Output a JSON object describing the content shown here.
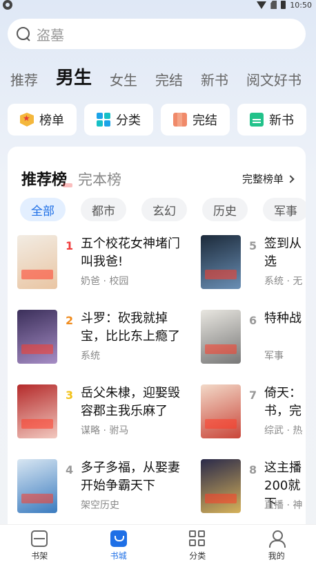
{
  "status_bar": {
    "time": "10:50"
  },
  "search": {
    "placeholder": "盗墓"
  },
  "top_tabs": [
    "推荐",
    "男生",
    "女生",
    "完结",
    "新书",
    "阅文好书"
  ],
  "shortcuts": [
    {
      "label": "榜单",
      "icon": "ranking-icon"
    },
    {
      "label": "分类",
      "icon": "category-icon"
    },
    {
      "label": "完结",
      "icon": "finished-books-icon"
    },
    {
      "label": "新书",
      "icon": "new-book-icon"
    }
  ],
  "ranking": {
    "tabs": [
      "推荐榜",
      "完本榜"
    ],
    "full_list_label": "完整榜单",
    "genres": [
      "全部",
      "都市",
      "玄幻",
      "历史",
      "军事"
    ],
    "books": [
      {
        "rank": "1",
        "title": "五个校花女神堵门叫我爸!",
        "tags": "奶爸 · 校园",
        "cover": [
          "#f2ece3",
          "#e9c5a3"
        ]
      },
      {
        "rank": "2",
        "title": "斗罗：砍我就掉宝，比比东上瘾了",
        "tags": "系统",
        "cover": [
          "#3b2f5a",
          "#a68dc5"
        ]
      },
      {
        "rank": "3",
        "title": "岳父朱棣，迎娶毁容郡主我乐麻了",
        "tags": "谋略 · 驸马",
        "cover": [
          "#b42a2a",
          "#f2c9c0"
        ]
      },
      {
        "rank": "4",
        "title": "多子多福，从娶妻开始争霸天下",
        "tags": "架空历史",
        "cover": [
          "#d8e6f2",
          "#3a7bbf"
        ]
      },
      {
        "rank": "5",
        "title": "签到从选",
        "tags": "系统 · 无",
        "cover": [
          "#1c2a3a",
          "#6a8fb5"
        ]
      },
      {
        "rank": "6",
        "title": "特种战",
        "tags": "军事",
        "cover": [
          "#e8e6e0",
          "#777"
        ]
      },
      {
        "rank": "7",
        "title": "倚天：书，完",
        "tags": "综武 · 热",
        "cover": [
          "#f2d9c8",
          "#c9463a"
        ]
      },
      {
        "rank": "8",
        "title": "这主播200就下",
        "tags": "直播 · 神",
        "cover": [
          "#2a2a4a",
          "#d6b25a"
        ]
      }
    ]
  },
  "bottom_nav": [
    {
      "label": "书架",
      "icon": "bookshelf-icon"
    },
    {
      "label": "书城",
      "icon": "bookstore-icon"
    },
    {
      "label": "分类",
      "icon": "category-grid-icon"
    },
    {
      "label": "我的",
      "icon": "profile-icon"
    }
  ],
  "colors": {
    "accent": "#1e6fe6",
    "rank1": "#f03c3c",
    "rank2": "#f08c1e",
    "rank3": "#f2c21a"
  }
}
